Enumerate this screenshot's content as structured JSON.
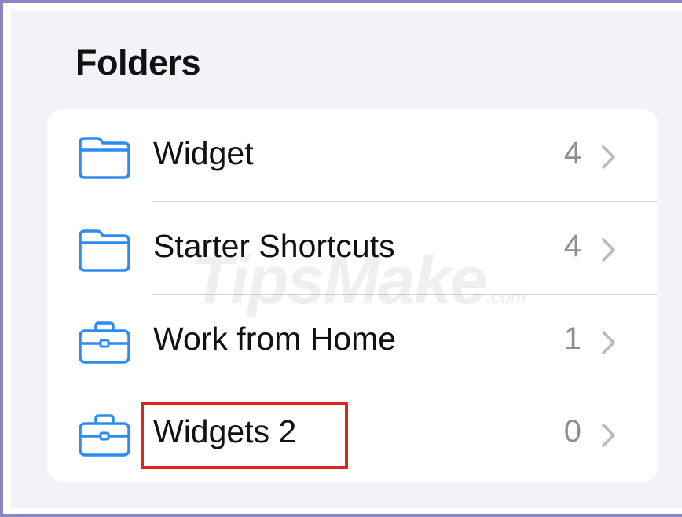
{
  "page": {
    "title": "Folders"
  },
  "folders": [
    {
      "name": "Widget",
      "count": "4",
      "icon": "folder-icon"
    },
    {
      "name": "Starter Shortcuts",
      "count": "4",
      "icon": "folder-icon"
    },
    {
      "name": "Work from Home",
      "count": "1",
      "icon": "briefcase-icon"
    },
    {
      "name": "Widgets 2",
      "count": "0",
      "icon": "briefcase-icon"
    }
  ],
  "highlighted_item": "Widgets 2",
  "watermark": {
    "brand": "TipsMake",
    "suffix": ".com"
  },
  "colors": {
    "accent": "#2d8cf0",
    "highlight": "#e0261b",
    "background": "#f2f2f7",
    "secondary_text": "#8e8e93"
  }
}
